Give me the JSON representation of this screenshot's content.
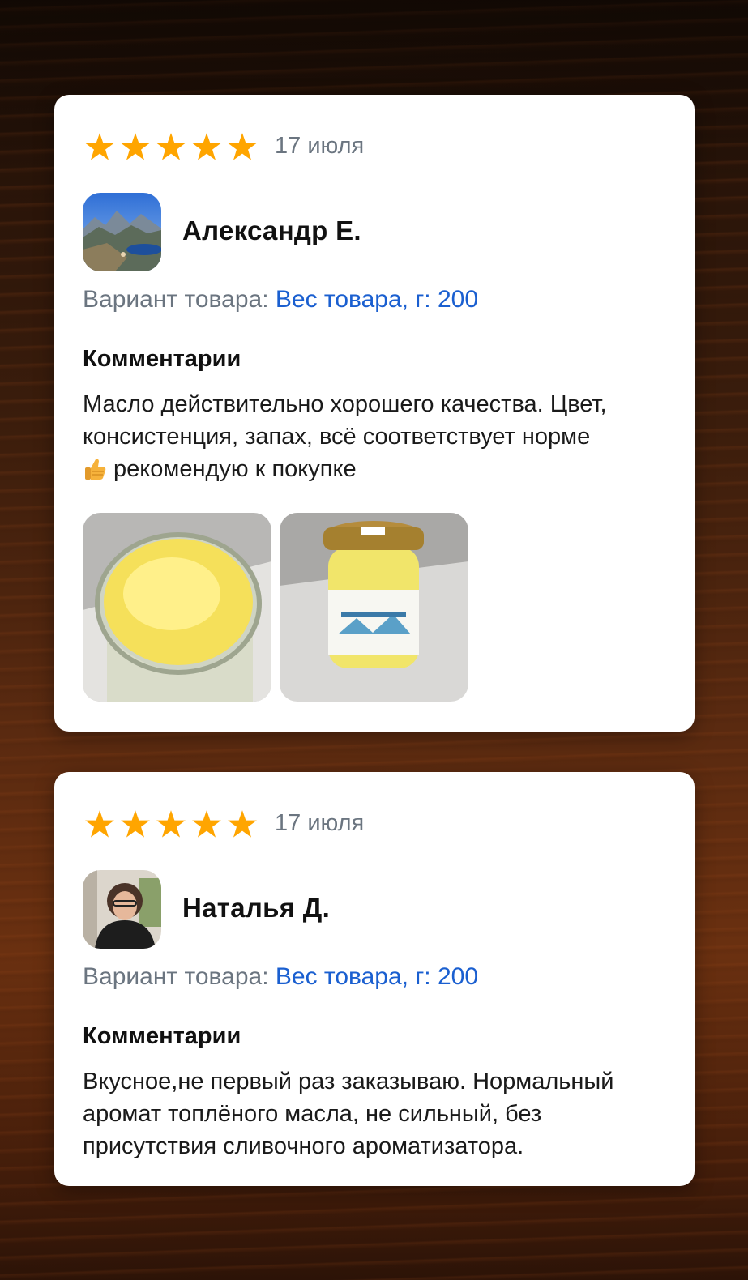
{
  "reviews": [
    {
      "rating": 5,
      "date": "17 июля",
      "author": "Александр Е.",
      "variant_label": "Вариант товара:",
      "variant_value": "Вес товара, г: 200",
      "comment_heading": "Комментарии",
      "comment_text": "Масло действительно хорошего качества. Цвет, консистенция, запах, всё соответствует норме",
      "comment_text_2": "рекомендую к покупке",
      "photos": [
        "butter-jar-open-photo",
        "butter-jar-closed-photo"
      ]
    },
    {
      "rating": 5,
      "date": "17 июля",
      "author": "Наталья Д.",
      "variant_label": "Вариант товара:",
      "variant_value": "Вес товара, г: 200",
      "comment_heading": "Комментарии",
      "comment_text": "Вкусное,не первый раз заказываю. Нормальный аромат топлёного масла, не сильный, без присутствия сливочного ароматизатора."
    }
  ],
  "colors": {
    "star": "#ffa500",
    "link": "#1a5fd0",
    "muted": "#6b7580"
  }
}
